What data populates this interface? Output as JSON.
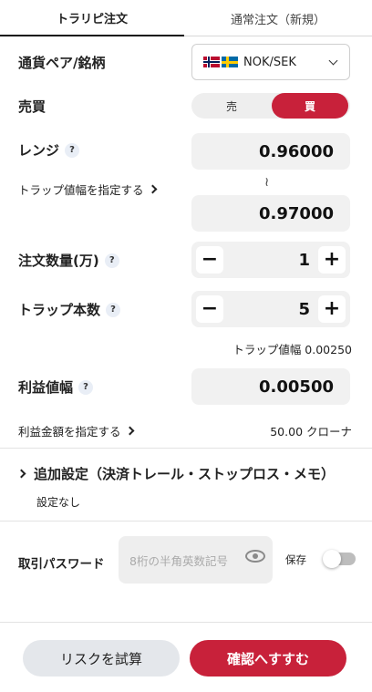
{
  "tabs": [
    {
      "label": "トラリピ注文"
    },
    {
      "label": "通常注文（新規）"
    }
  ],
  "currency_pair": {
    "label": "通貨ペア/銘柄",
    "value": "NOK/SEK"
  },
  "side": {
    "label": "売買",
    "sell": "売",
    "buy": "買",
    "selected": "買"
  },
  "range": {
    "label": "レンジ",
    "help": "?",
    "link": "トラップ値幅を指定する",
    "low": "0.96000",
    "separator": "≀",
    "high": "0.97000"
  },
  "quantity": {
    "label": "注文数量(万)",
    "help": "?",
    "value": "1",
    "minus": "−",
    "plus": "+"
  },
  "trap_count": {
    "label": "トラップ本数",
    "help": "?",
    "value": "5",
    "minus": "−",
    "plus": "+",
    "width_text": "トラップ値幅 0.00250"
  },
  "profit": {
    "label": "利益値幅",
    "help": "?",
    "value": "0.00500",
    "link": "利益金額を指定する",
    "amount": "50.00 クローナ"
  },
  "advanced": {
    "label": "追加設定（決済トレール・ストップロス・メモ）",
    "status": "設定なし"
  },
  "password": {
    "label": "取引パスワード",
    "placeholder": "8桁の半角英数記号",
    "save_label": "保存",
    "save_on": false
  },
  "buttons": {
    "risk": "リスクを試算",
    "confirm": "確認へすすむ"
  },
  "colors": {
    "accent": "#c8213a",
    "field_bg": "#f1f1f1"
  }
}
